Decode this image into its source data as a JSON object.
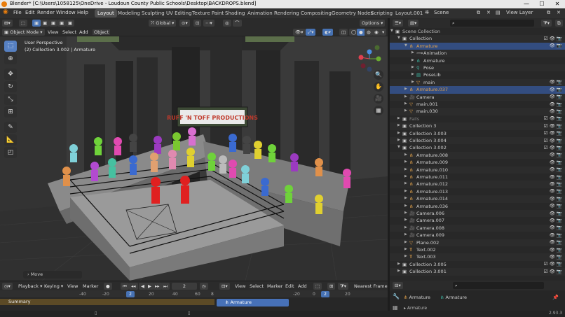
{
  "window": {
    "title": "Blender* [C:\\Users\\1058125\\OneDrive - Loudoun County Public Schools\\Desktop\\BACKDROPS.blend]",
    "minimize": "—",
    "maximize": "☐",
    "close": "✕"
  },
  "menu": {
    "items": [
      "File",
      "Edit",
      "Render",
      "Window",
      "Help"
    ]
  },
  "workspaces": [
    "Layout",
    "Modeling",
    "Sculpting",
    "UV Editing",
    "Texture Paint",
    "Shading",
    "Animation",
    "Rendering",
    "Compositing",
    "Geometry Nodes",
    "Scripting",
    "Layout.001"
  ],
  "active_workspace": "Layout",
  "scene": {
    "label": "Scene",
    "view_layer": "View Layer"
  },
  "viewport_header": {
    "mode": "Object Mode",
    "menus": [
      "View",
      "Select",
      "Add",
      "Object"
    ],
    "transform_orientation": "Global",
    "options": "Options"
  },
  "viewport": {
    "perspective": "User Perspective",
    "context": "(2) Collection 3.002 | Armature",
    "sign_text": "RUFF 'N TOFF PRODUCTIONS",
    "last_operator": "Move"
  },
  "tools": [
    "select-box",
    "cursor",
    "move",
    "rotate",
    "scale",
    "transform",
    "annotate",
    "measure",
    "add-cube"
  ],
  "timeline": {
    "menus": [
      "Playback",
      "Keying",
      "View",
      "Marker"
    ],
    "current_frame": "2",
    "ruler_left": [
      "-40",
      "-20",
      "2",
      "20",
      "40",
      "60",
      "8"
    ],
    "summary_label": "Summary",
    "nla_menus": [
      "View",
      "Select",
      "Marker",
      "Add"
    ],
    "nla_frame": "Nearest Frame",
    "nla_ruler": [
      "-20",
      "0",
      "2",
      "20"
    ],
    "nla_strip": "Armature"
  },
  "outliner": {
    "search_placeholder": "",
    "rows": [
      {
        "indent": 0,
        "label": "Scene Collection",
        "type": "collection",
        "color": "#bfbfbf",
        "expanded": true,
        "vis": false
      },
      {
        "indent": 1,
        "label": "Collection",
        "type": "collection",
        "color": "#cfcfcf",
        "expanded": true,
        "vis": true
      },
      {
        "indent": 2,
        "label": "Armature",
        "type": "armature",
        "color": "#e3a24a",
        "expanded": true,
        "vis": true,
        "selected": true
      },
      {
        "indent": 3,
        "label": "Animation",
        "type": "anim",
        "color": "#cfcfcf",
        "expanded": false,
        "vis": false
      },
      {
        "indent": 3,
        "label": "Armature",
        "type": "armdata",
        "color": "#cfcfcf",
        "expanded": false,
        "vis": false
      },
      {
        "indent": 3,
        "label": "Pose",
        "type": "pose",
        "color": "#cfcfcf",
        "expanded": false,
        "vis": false
      },
      {
        "indent": 3,
        "label": "PoseLib",
        "type": "poselib",
        "color": "#cfcfcf",
        "expanded": false,
        "vis": false
      },
      {
        "indent": 3,
        "label": "main",
        "type": "mesh",
        "color": "#cfcfcf",
        "expanded": false,
        "vis": true
      },
      {
        "indent": 2,
        "label": "Armature.037",
        "type": "armature",
        "color": "#e3a24a",
        "expanded": false,
        "vis": true,
        "active": true
      },
      {
        "indent": 2,
        "label": "Camera",
        "type": "camera",
        "color": "#cfcfcf",
        "expanded": false,
        "vis": true
      },
      {
        "indent": 2,
        "label": "main.001",
        "type": "mesh",
        "color": "#cfcfcf",
        "expanded": false,
        "vis": true
      },
      {
        "indent": 2,
        "label": "main.030",
        "type": "mesh",
        "color": "#cfcfcf",
        "expanded": false,
        "vis": true
      },
      {
        "indent": 1,
        "label": "Fails",
        "type": "collection",
        "color": "#808080",
        "expanded": false,
        "vis": true
      },
      {
        "indent": 1,
        "label": "Collection 3",
        "type": "collection",
        "color": "#cfcfcf",
        "expanded": false,
        "vis": true
      },
      {
        "indent": 1,
        "label": "Collection 3.003",
        "type": "collection",
        "color": "#cfcfcf",
        "expanded": false,
        "vis": true
      },
      {
        "indent": 1,
        "label": "Collection 3.004",
        "type": "collection",
        "color": "#cfcfcf",
        "expanded": false,
        "vis": true
      },
      {
        "indent": 1,
        "label": "Collection 3.002",
        "type": "collection",
        "color": "#cfcfcf",
        "expanded": true,
        "vis": true
      },
      {
        "indent": 2,
        "label": "Armature.008",
        "type": "armature",
        "color": "#cfcfcf",
        "expanded": false,
        "vis": true
      },
      {
        "indent": 2,
        "label": "Armature.009",
        "type": "armature",
        "color": "#cfcfcf",
        "expanded": false,
        "vis": true
      },
      {
        "indent": 2,
        "label": "Armature.010",
        "type": "armature",
        "color": "#cfcfcf",
        "expanded": false,
        "vis": true
      },
      {
        "indent": 2,
        "label": "Armature.011",
        "type": "armature",
        "color": "#cfcfcf",
        "expanded": false,
        "vis": true
      },
      {
        "indent": 2,
        "label": "Armature.012",
        "type": "armature",
        "color": "#cfcfcf",
        "expanded": false,
        "vis": true
      },
      {
        "indent": 2,
        "label": "Armature.013",
        "type": "armature",
        "color": "#cfcfcf",
        "expanded": false,
        "vis": true
      },
      {
        "indent": 2,
        "label": "Armature.014",
        "type": "armature",
        "color": "#cfcfcf",
        "expanded": false,
        "vis": true
      },
      {
        "indent": 2,
        "label": "Armature.036",
        "type": "armature",
        "color": "#cfcfcf",
        "expanded": false,
        "vis": true
      },
      {
        "indent": 2,
        "label": "Camera.006",
        "type": "camera",
        "color": "#cfcfcf",
        "expanded": false,
        "vis": true
      },
      {
        "indent": 2,
        "label": "Camera.007",
        "type": "camera",
        "color": "#cfcfcf",
        "expanded": false,
        "vis": true
      },
      {
        "indent": 2,
        "label": "Camera.008",
        "type": "camera",
        "color": "#cfcfcf",
        "expanded": false,
        "vis": true
      },
      {
        "indent": 2,
        "label": "Camera.009",
        "type": "camera",
        "color": "#cfcfcf",
        "expanded": false,
        "vis": true
      },
      {
        "indent": 2,
        "label": "Plane.002",
        "type": "mesh",
        "color": "#cfcfcf",
        "expanded": false,
        "vis": true
      },
      {
        "indent": 2,
        "label": "Text.002",
        "type": "text",
        "color": "#cfcfcf",
        "expanded": false,
        "vis": true
      },
      {
        "indent": 2,
        "label": "Text.003",
        "type": "text",
        "color": "#cfcfcf",
        "expanded": false,
        "vis": true
      },
      {
        "indent": 1,
        "label": "Collection 3.005",
        "type": "collection",
        "color": "#cfcfcf",
        "expanded": false,
        "vis": true
      },
      {
        "indent": 1,
        "label": "Collection 3.001",
        "type": "collection",
        "color": "#cfcfcf",
        "expanded": false,
        "vis": true
      }
    ]
  },
  "properties": {
    "object_name": "Armature",
    "data_name": "Armature"
  },
  "status": {
    "version": "2.93.3"
  },
  "colors": {
    "accent": "#4772b3",
    "selected_row": "#334d80",
    "armature_orange": "#e3a24a",
    "mesh_teal": "#3fb8a4"
  }
}
